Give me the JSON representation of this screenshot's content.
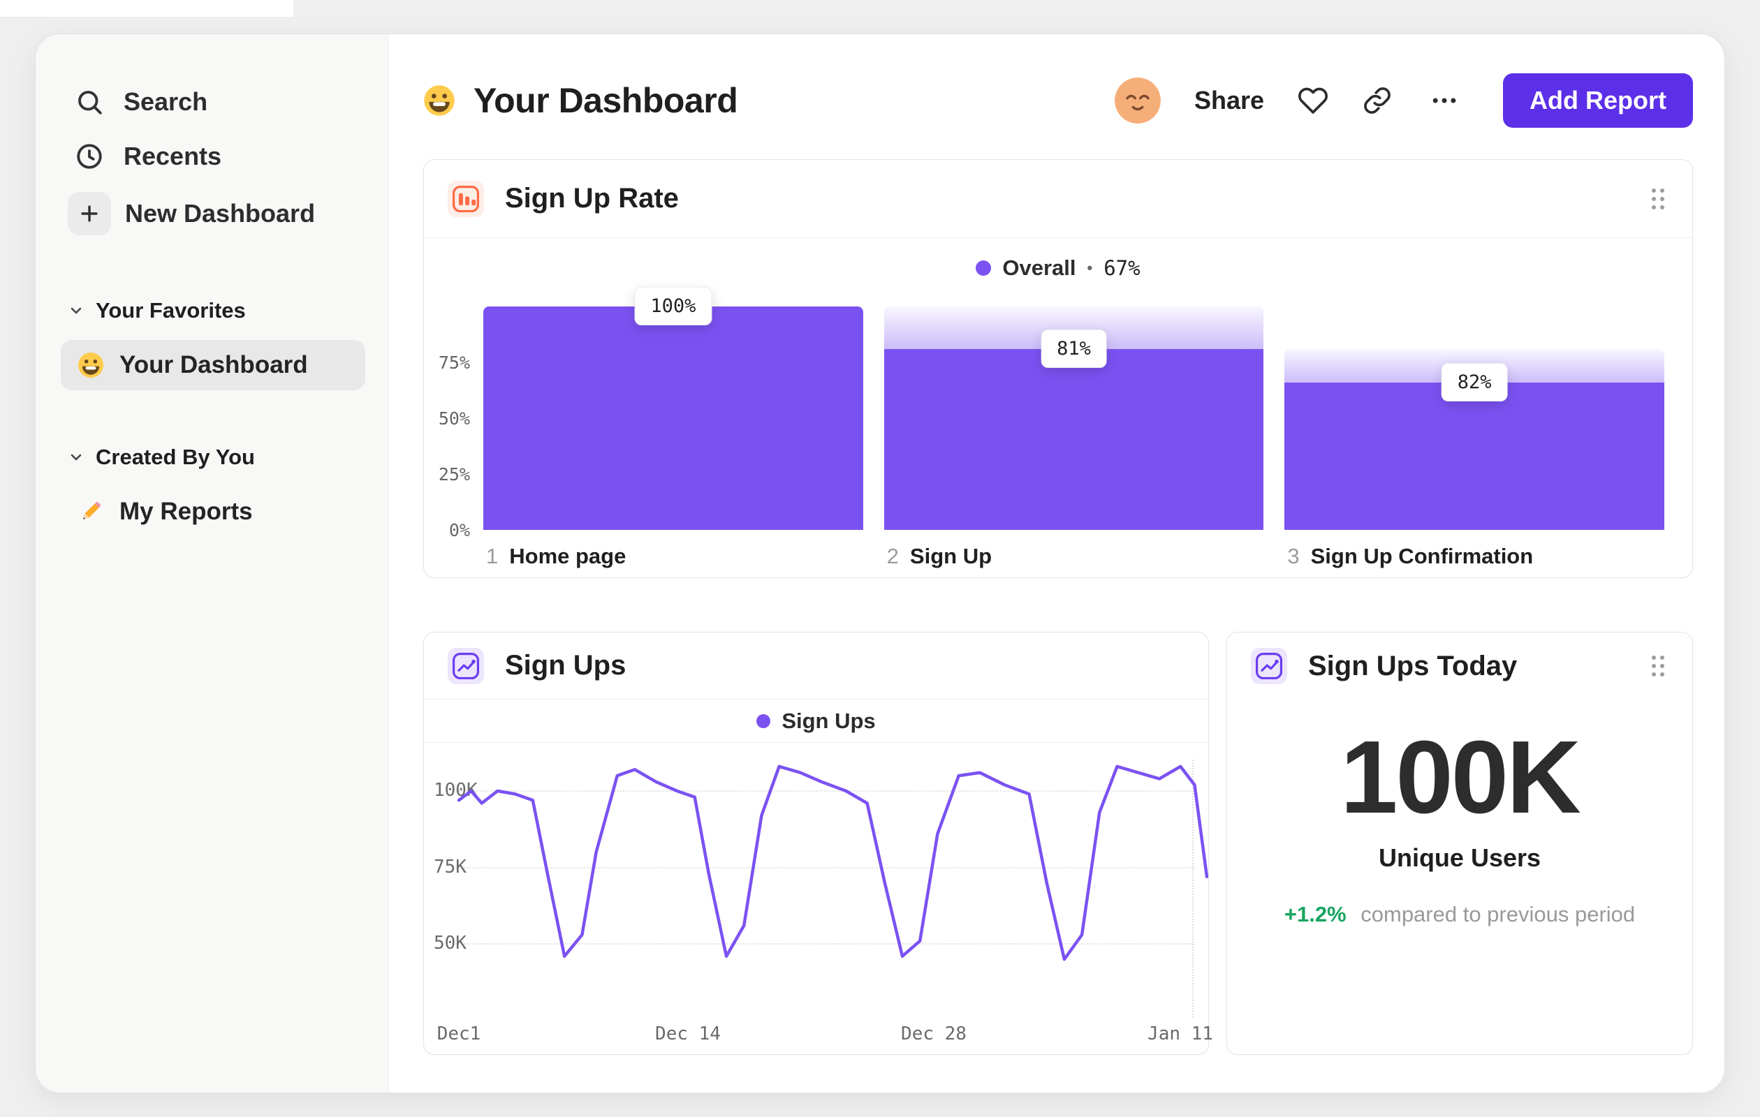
{
  "app": {
    "accent_purple": "#7b52f2",
    "button_purple": "#5c2fe8",
    "accent_orange": "#ff6a45",
    "sidebar_bg": "#f8f8f7"
  },
  "sidebar": {
    "search": "Search",
    "recents": "Recents",
    "new_dashboard": "New Dashboard",
    "favorites_title": "Your Favorites",
    "favorite_item": "Your Dashboard",
    "created_title": "Created By You",
    "reports_item": "My Reports"
  },
  "header": {
    "title": "Your Dashboard",
    "share": "Share",
    "add_report": "Add Report"
  },
  "funnel": {
    "title": "Sign Up Rate",
    "legend_label": "Overall",
    "legend_sep": "•",
    "legend_value": "67%",
    "y_labels": [
      "75%",
      "50%",
      "25%",
      "0%"
    ],
    "steps": [
      {
        "index": "1",
        "label": "Home page",
        "value": "100%"
      },
      {
        "index": "2",
        "label": "Sign Up",
        "value": "81%"
      },
      {
        "index": "3",
        "label": "Sign Up Confirmation",
        "value": "82%"
      }
    ]
  },
  "signups": {
    "title": "Sign Ups",
    "legend_label": "Sign Ups",
    "y_labels": [
      "100K",
      "75K",
      "50K"
    ],
    "x_labels": [
      "Dec1",
      "Dec 14",
      "Dec 28",
      "Jan 11"
    ]
  },
  "today": {
    "title": "Sign Ups Today",
    "value": "100K",
    "subtitle": "Unique Users",
    "delta": "+1.2%",
    "delta_note": "compared to previous period",
    "delta_color": "#17a562"
  },
  "chart_data": [
    {
      "type": "bar",
      "subtype": "funnel",
      "title": "Sign Up Rate",
      "legend": "Overall",
      "overall_conversion_pct": 67,
      "categories": [
        "Home page",
        "Sign Up",
        "Sign Up Confirmation"
      ],
      "step_conversion_pct": [
        100,
        81,
        82
      ],
      "bar_solid_pct": [
        100,
        81,
        66
      ],
      "bar_fade_top_pct": [
        100,
        100,
        81
      ],
      "ylim": [
        0,
        100
      ],
      "y_ticks": [
        0,
        25,
        50,
        75
      ],
      "grid": false,
      "legend_position": "top-center"
    },
    {
      "type": "line",
      "title": "Sign Ups",
      "series_name": "Sign Ups",
      "x_unit": "days_after_Dec_1",
      "x_ticks": [
        {
          "x": 0,
          "label": "Dec1"
        },
        {
          "x": 13,
          "label": "Dec 14"
        },
        {
          "x": 27,
          "label": "Dec 28"
        },
        {
          "x": 41,
          "label": "Jan 11"
        }
      ],
      "y_ticks": [
        50,
        75,
        100
      ],
      "y_unit": "K users",
      "ylim": [
        40,
        114
      ],
      "grid": "dotted-horizontal",
      "legend_position": "top-center",
      "points": [
        [
          0,
          97
        ],
        [
          0.7,
          100
        ],
        [
          1.3,
          96
        ],
        [
          2.2,
          100
        ],
        [
          3.2,
          99
        ],
        [
          4.2,
          97
        ],
        [
          5,
          74
        ],
        [
          6,
          46
        ],
        [
          7,
          53
        ],
        [
          7.8,
          80
        ],
        [
          9,
          105
        ],
        [
          10,
          107
        ],
        [
          11.2,
          103
        ],
        [
          12.4,
          100
        ],
        [
          13.4,
          98
        ],
        [
          14.2,
          73
        ],
        [
          15.2,
          46
        ],
        [
          16.2,
          56
        ],
        [
          17.2,
          92
        ],
        [
          18.2,
          108
        ],
        [
          19.4,
          106
        ],
        [
          20.6,
          103
        ],
        [
          22,
          100
        ],
        [
          23.2,
          96
        ],
        [
          24.2,
          70
        ],
        [
          25.2,
          46
        ],
        [
          26.2,
          51
        ],
        [
          27.2,
          86
        ],
        [
          28.4,
          105
        ],
        [
          29.6,
          106
        ],
        [
          31,
          102
        ],
        [
          32.4,
          99
        ],
        [
          33.4,
          70
        ],
        [
          34.4,
          45
        ],
        [
          35.4,
          53
        ],
        [
          36.4,
          93
        ],
        [
          37.4,
          108
        ],
        [
          38.6,
          106
        ],
        [
          39.8,
          104
        ],
        [
          41,
          108
        ],
        [
          41.8,
          102
        ],
        [
          42.5,
          72
        ]
      ]
    }
  ]
}
